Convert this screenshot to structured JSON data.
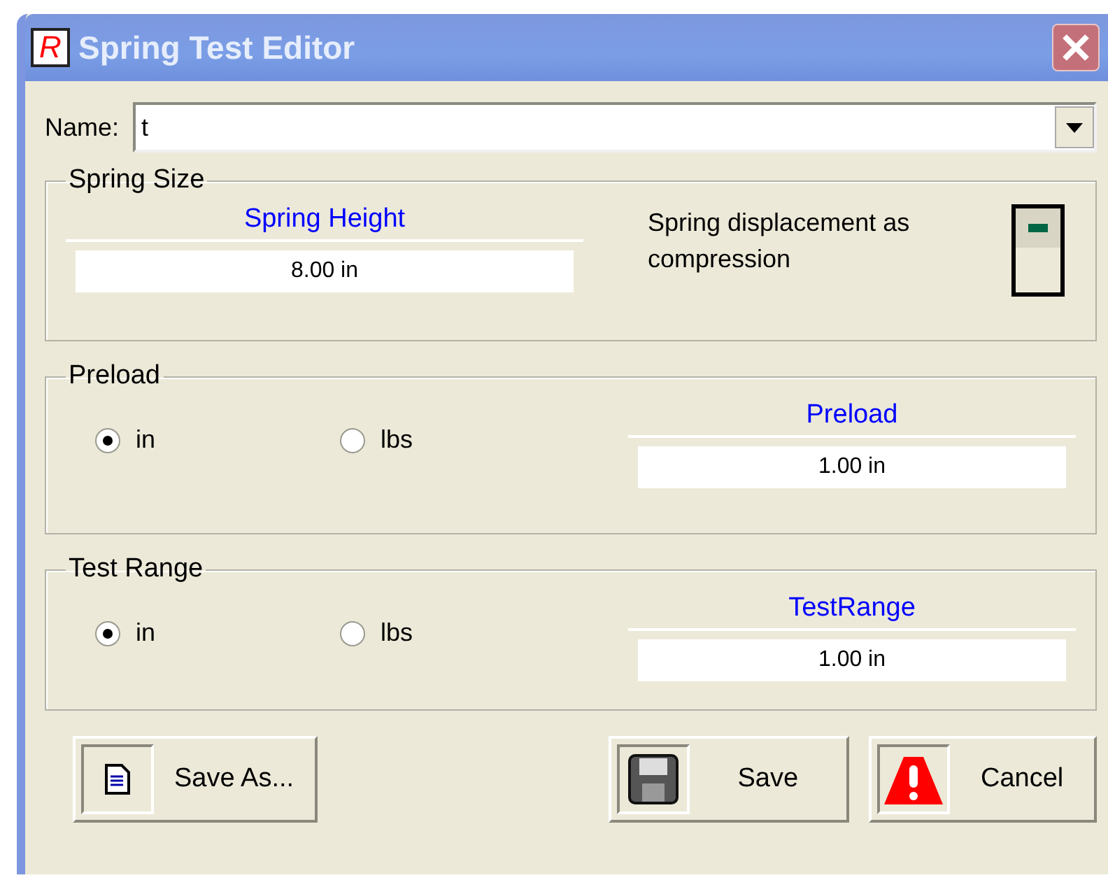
{
  "window": {
    "title": "Spring Test Editor",
    "app_icon": "R"
  },
  "name_field": {
    "label": "Name:",
    "value": "t"
  },
  "spring_size": {
    "legend": "Spring Size",
    "heading": "Spring Height",
    "value": "8.00 in",
    "switch_label": "Spring displacement as compression",
    "switch_on": true
  },
  "groups": [
    {
      "legend": "Preload",
      "options": [
        {
          "label": "in",
          "selected": true
        },
        {
          "label": "lbs",
          "selected": false
        }
      ],
      "heading": "Preload",
      "value": "1.00 in"
    },
    {
      "legend": "Test Range",
      "options": [
        {
          "label": "in",
          "selected": true
        },
        {
          "label": "lbs",
          "selected": false
        }
      ],
      "heading": "TestRange",
      "value": "1.00 in"
    }
  ],
  "buttons": [
    {
      "kind": "saveas",
      "label": "Save As..."
    },
    {
      "kind": "save",
      "label": "Save"
    },
    {
      "kind": "cancel",
      "label": "Cancel"
    }
  ]
}
